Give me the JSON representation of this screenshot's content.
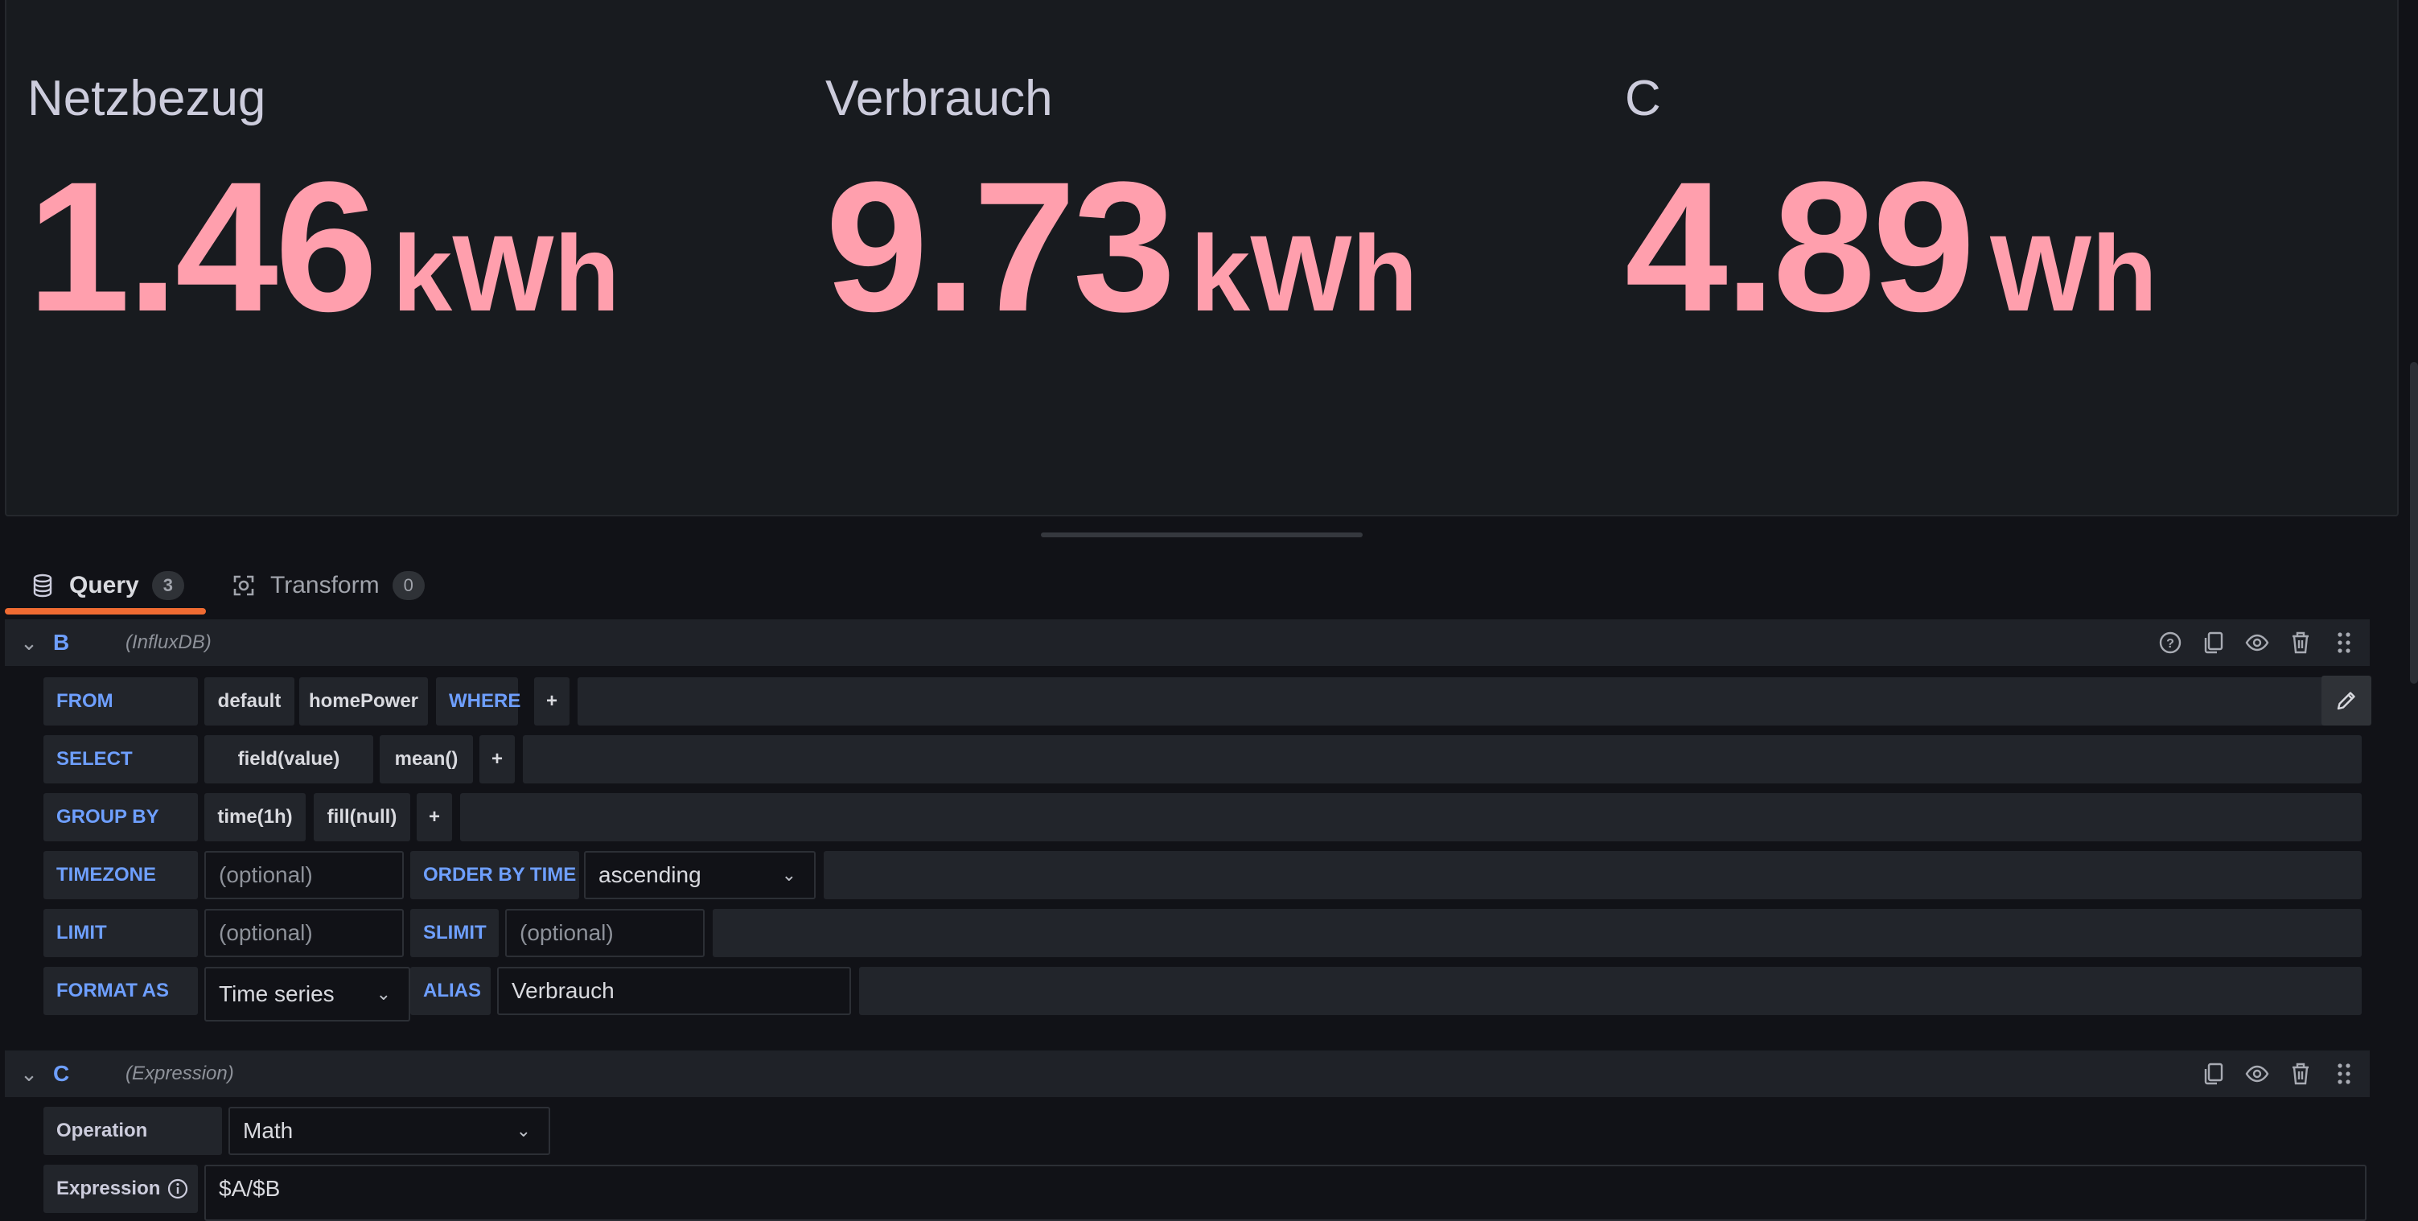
{
  "stats": [
    {
      "title": "Netzbezug",
      "value": "1.46",
      "unit": "kWh"
    },
    {
      "title": "Verbrauch",
      "value": "9.73",
      "unit": "kWh"
    },
    {
      "title": "C",
      "value": "4.89",
      "unit": "Wh"
    }
  ],
  "tabs": [
    {
      "label": "Query",
      "count": "3",
      "icon": "database-icon",
      "active": true
    },
    {
      "label": "Transform",
      "count": "0",
      "icon": "transform-icon",
      "active": false
    }
  ],
  "query_b": {
    "ref_id": "B",
    "datasource": "(InfluxDB)",
    "from": {
      "keyword": "FROM",
      "policy": "default",
      "measurement": "homePower",
      "where": "WHERE",
      "add": "+"
    },
    "select": {
      "keyword": "SELECT",
      "field": "field(value)",
      "agg": "mean()",
      "add": "+"
    },
    "group_by": {
      "keyword": "GROUP BY",
      "time": "time(1h)",
      "fill": "fill(null)",
      "add": "+"
    },
    "timezone": {
      "keyword": "TIMEZONE",
      "placeholder": "(optional)",
      "order_label": "ORDER BY TIME",
      "order_value": "ascending"
    },
    "limit": {
      "keyword": "LIMIT",
      "placeholder": "(optional)",
      "slimit_label": "SLIMIT",
      "slimit_placeholder": "(optional)"
    },
    "format": {
      "keyword": "FORMAT AS",
      "value": "Time series",
      "alias_label": "ALIAS",
      "alias_value": "Verbrauch"
    }
  },
  "query_c": {
    "ref_id": "C",
    "datasource": "(Expression)",
    "operation_label": "Operation",
    "operation_value": "Math",
    "expression_label": "Expression",
    "expression_value": "$A/$B"
  },
  "colors": {
    "stat_value": "#ff9fad",
    "keyword": "#6e9fff",
    "active_tab": "#f06b32",
    "background": "#111217"
  }
}
